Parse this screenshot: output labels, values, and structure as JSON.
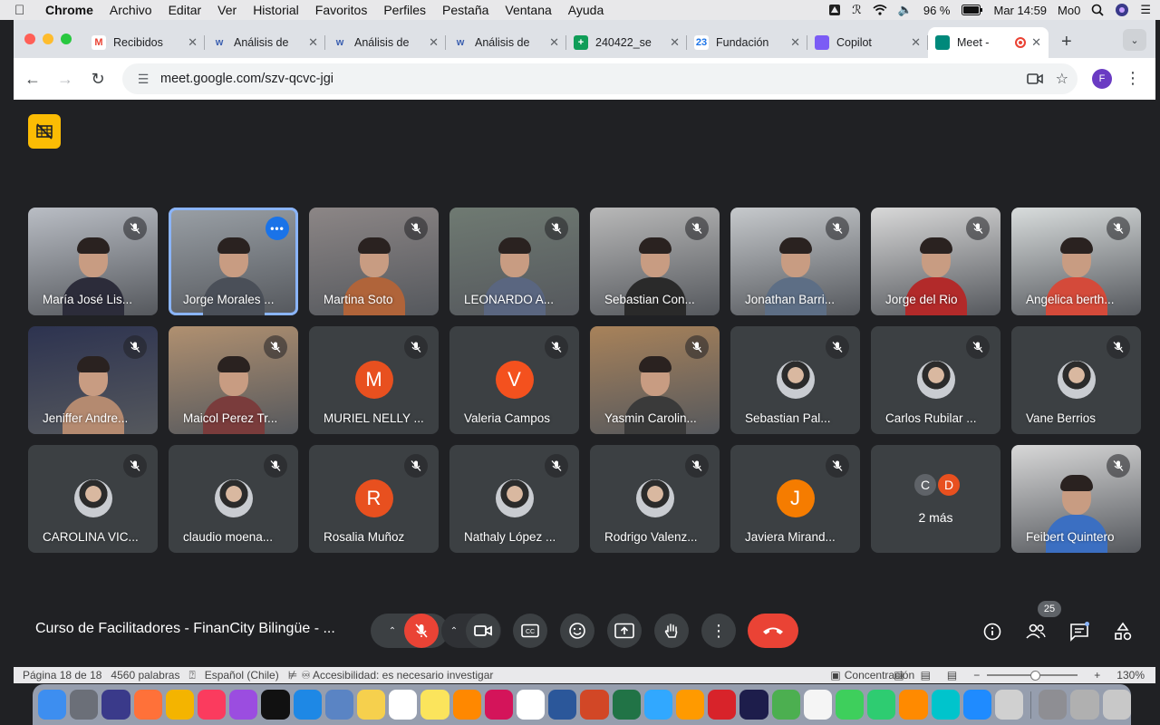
{
  "menubar": {
    "app": "Chrome",
    "items": [
      "Archivo",
      "Editar",
      "Ver",
      "Historial",
      "Favoritos",
      "Perfiles",
      "Pestaña",
      "Ventana",
      "Ayuda"
    ],
    "battery": "96 %",
    "clock": "Mar 14:59",
    "user": "Mo0"
  },
  "tabs": [
    {
      "title": "Recibidos",
      "fav": "M",
      "fav_color": "#ea4335",
      "fav_bg": "#ffffff"
    },
    {
      "title": "Análisis de",
      "fav": "w",
      "fav_color": "#3b5fb0",
      "fav_bg": "#dee1e6"
    },
    {
      "title": "Análisis de",
      "fav": "w",
      "fav_color": "#3b5fb0",
      "fav_bg": "#dee1e6"
    },
    {
      "title": "Análisis de",
      "fav": "w",
      "fav_color": "#3b5fb0",
      "fav_bg": "#dee1e6"
    },
    {
      "title": "240422_se",
      "fav": "+",
      "fav_color": "#ffffff",
      "fav_bg": "#0f9d58"
    },
    {
      "title": "Fundación",
      "fav": "23",
      "fav_color": "#1a73e8",
      "fav_bg": "#ffffff"
    },
    {
      "title": "Copilot",
      "fav": "",
      "fav_color": "#ffffff",
      "fav_bg": "#7b5cf5"
    },
    {
      "title": "Meet -",
      "fav": "",
      "fav_color": "#ffffff",
      "fav_bg": "#00897b",
      "active": true
    }
  ],
  "address": {
    "url": "meet.google.com/szv-qcvc-jgi"
  },
  "profile_initial": "F",
  "participants": [
    {
      "name": "María José Lis...",
      "type": "video",
      "shirt": "#2c2c3a",
      "bg": "#b9bdc4"
    },
    {
      "name": "Jorge Morales ...",
      "type": "video",
      "shirt": "#4a4f58",
      "bg": "#9aa0a6",
      "highlight": true,
      "more": true
    },
    {
      "name": "Martina Soto",
      "type": "video",
      "shirt": "#b0643a",
      "bg": "#8c8686"
    },
    {
      "name": "LEONARDO A...",
      "type": "video",
      "shirt": "#5a6680",
      "bg": "#6f7a72"
    },
    {
      "name": "Sebastian Con...",
      "type": "video",
      "shirt": "#2a2a2a",
      "bg": "#b8b8b8"
    },
    {
      "name": "Jonathan Barri...",
      "type": "video",
      "shirt": "#5d6e85",
      "bg": "#c6c9cc"
    },
    {
      "name": "Jorge del Rio",
      "type": "video",
      "shirt": "#b22a2a",
      "bg": "#d8d8d8"
    },
    {
      "name": "Angelica berth...",
      "type": "video",
      "shirt": "#d44a3a",
      "bg": "#d8dcdc"
    },
    {
      "name": "Jeniffer Andre...",
      "type": "video",
      "shirt": "#b48a70",
      "bg": "#2d3350"
    },
    {
      "name": "Maicol Perez Tr...",
      "type": "video",
      "shirt": "#7a3c3c",
      "bg": "#b09070"
    },
    {
      "name": "MURIEL NELLY ...",
      "type": "initial",
      "initial": "M",
      "color": "#e8501f"
    },
    {
      "name": "Valeria Campos",
      "type": "initial",
      "initial": "V",
      "color": "#f4511e"
    },
    {
      "name": "Yasmin Carolin...",
      "type": "video",
      "shirt": "#3a3a3a",
      "bg": "#a8825a"
    },
    {
      "name": "Sebastian Pal...",
      "type": "photo"
    },
    {
      "name": "Carlos Rubilar ...",
      "type": "photo"
    },
    {
      "name": "Vane Berrios",
      "type": "photo"
    },
    {
      "name": "CAROLINA VIC...",
      "type": "photo"
    },
    {
      "name": "claudio moena...",
      "type": "photo"
    },
    {
      "name": "Rosalia Muñoz",
      "type": "initial",
      "initial": "R",
      "color": "#e8501f"
    },
    {
      "name": "Nathaly López ...",
      "type": "photo"
    },
    {
      "name": "Rodrigo Valenz...",
      "type": "photo"
    },
    {
      "name": "Javiera Mirand...",
      "type": "initial",
      "initial": "J",
      "color": "#f57c00"
    },
    {
      "name": "",
      "type": "others",
      "initials": [
        "C",
        "D"
      ],
      "colors": [
        "#5f6368",
        "#e8501f"
      ],
      "label": "2 más"
    },
    {
      "name": "Feibert Quintero",
      "type": "video",
      "shirt": "#3b6fc2",
      "bg": "#d8d8d8"
    }
  ],
  "meeting": {
    "title": "Curso de Facilitadores - FinanCity Bilingüe - ...",
    "participant_count": "25"
  },
  "wordbar": {
    "page": "Página 18 de 18",
    "words": "4560 palabras",
    "language": "Español (Chile)",
    "accessibility": "Accesibilidad: es necesario investigar",
    "focus": "Concentración",
    "zoom": "130%"
  },
  "dock": [
    "Finder",
    "Launchpad",
    "Siri",
    "Firefox",
    "Chrome",
    "Music",
    "Podcasts",
    "TV",
    "Safari",
    "Preview",
    "Notes",
    "Calendar",
    "Stickies",
    "VLC",
    "InDesign",
    "Lists",
    "Word",
    "PowerPoint",
    "Excel",
    "Photoshop",
    "Illustrator",
    "Acrobat",
    "Klaxoon",
    "Maps",
    "Photos",
    "Messages",
    "FaceTime",
    "Books",
    "Canva",
    "App Store",
    "Block",
    "Settings",
    "Library",
    "Trash"
  ],
  "colors": {
    "accent": "#8ab4f8",
    "hangup": "#ea4335",
    "meet_bg": "#202124",
    "tile_bg": "#3c4043"
  }
}
